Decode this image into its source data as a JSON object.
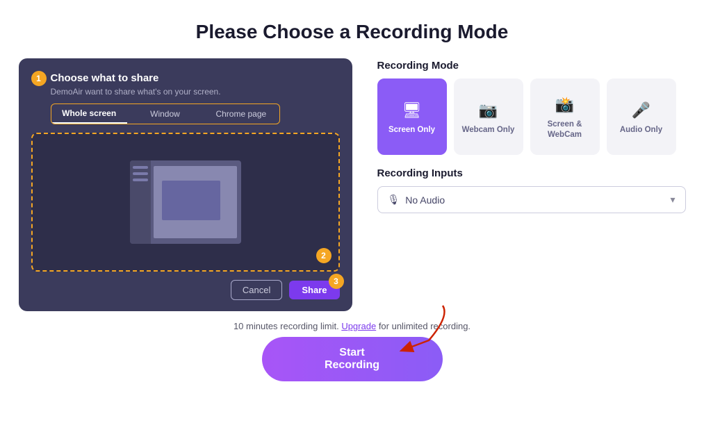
{
  "page": {
    "title": "Please Choose a Recording Mode"
  },
  "dialog": {
    "title": "Choose what to share",
    "subtitle": "DemoAir want to share what's on your screen.",
    "tabs": [
      {
        "label": "Whole screen",
        "active": true
      },
      {
        "label": "Window",
        "active": false
      },
      {
        "label": "Chrome page",
        "active": false
      }
    ],
    "cancel_label": "Cancel",
    "share_label": "Share"
  },
  "recording_mode": {
    "section_label": "Recording Mode",
    "modes": [
      {
        "id": "screen-only",
        "label": "Screen Only",
        "icon": "🖥",
        "active": true
      },
      {
        "id": "webcam-only",
        "label": "Webcam Only",
        "icon": "📷",
        "active": false
      },
      {
        "id": "screen-webcam",
        "label": "Screen & WebCam",
        "icon": "📸",
        "active": false
      },
      {
        "id": "audio-only",
        "label": "Audio Only",
        "icon": "🎤",
        "active": false
      }
    ]
  },
  "recording_inputs": {
    "section_label": "Recording Inputs",
    "dropdown_value": "No Audio",
    "dropdown_icon": "🎙"
  },
  "bottom": {
    "limit_text": "10 minutes recording limit.",
    "upgrade_label": "Upgrade",
    "upgrade_suffix": " for unlimited recording.",
    "start_label": "Start Recording"
  }
}
